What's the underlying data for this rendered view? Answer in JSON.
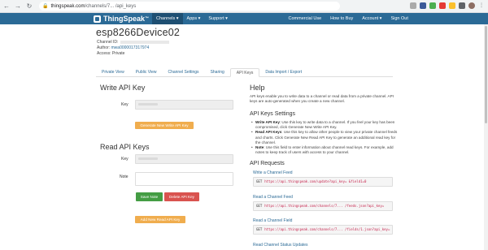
{
  "browser": {
    "url_host": "thingspeak.com",
    "url_path": "/channels/7...          /api_keys"
  },
  "navbar": {
    "brand": "ThingSpeak",
    "brand_mark": "™",
    "left_items": [
      "Channels ▾",
      "Apps ▾",
      "Support ▾"
    ],
    "right_items": [
      "Commercial Use",
      "How to Buy",
      "Account ▾",
      "Sign Out"
    ]
  },
  "channel": {
    "title": "esp8266Device02",
    "id_label": "Channel ID:",
    "author_label": "Author:",
    "author_value": "mwa0000017317974",
    "access_label": "Access:",
    "access_value": "Private"
  },
  "tabs": [
    "Private View",
    "Public View",
    "Channel Settings",
    "Sharing",
    "API Keys",
    "Data Import / Export"
  ],
  "write": {
    "heading": "Write API Key",
    "key_label": "Key",
    "generate_button": "Generate New Write API Key"
  },
  "read": {
    "heading": "Read API Keys",
    "key_label": "Key",
    "note_label": "Note",
    "save_button": "Save Note",
    "delete_button": "Delete API Key",
    "add_button": "Add New Read API Key"
  },
  "help": {
    "heading": "Help",
    "intro": "API keys enable you to write data to a channel or read data from a private channel. API keys are auto-generated when you create a new channel.",
    "settings_heading": "API Keys Settings",
    "bullets": [
      {
        "bold": "Write API Key",
        "text": ": Use this key to write data to a channel. If you feel your key has been compromised, click Generate New Write API Key."
      },
      {
        "bold": "Read API Keys",
        "text": ": Use this key to allow other people to view your private channel feeds and charts. Click Generate New Read API Key to generate an additional read key for the channel."
      },
      {
        "bold": "Note",
        "text": ": Use this field to enter information about channel read keys. For example, add notes to keep track of users with access to your channel."
      }
    ],
    "requests_heading": "API Requests",
    "requests": [
      {
        "title": "Write a Channel Feed",
        "verb": "GET",
        "url": "https://api.thingspeak.com/update?api_key=          &field1=0"
      },
      {
        "title": "Read a Channel Feed",
        "verb": "GET",
        "url": "https://api.thingspeak.com/channels/7...     /feeds.json?api_key="
      },
      {
        "title": "Read a Channel Field",
        "verb": "GET",
        "url": "https://api.thingspeak.com/channels/7...   /fields/1.json?api_key="
      },
      {
        "title": "Read Channel Status Updates"
      }
    ]
  }
}
